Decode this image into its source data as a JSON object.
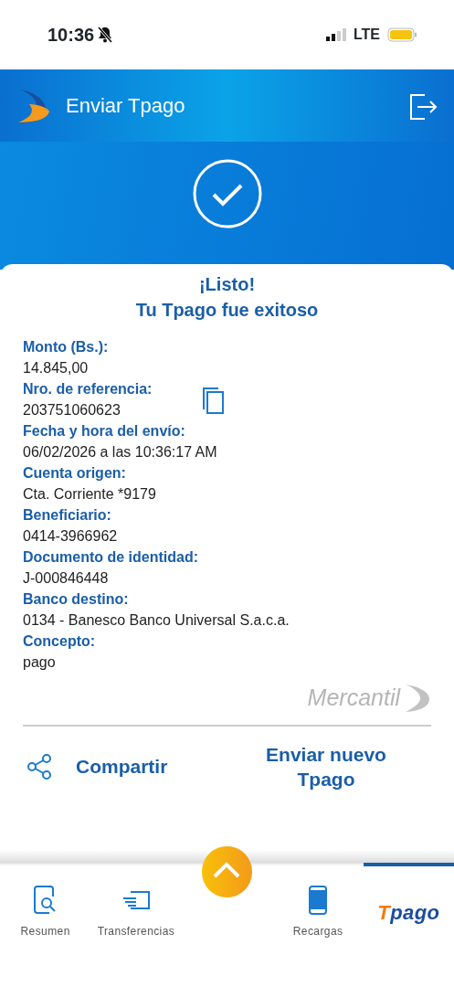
{
  "status_bar": {
    "time": "10:36",
    "network": "LTE",
    "silenced": true
  },
  "header": {
    "title": "Enviar Tpago"
  },
  "receipt": {
    "title": "¡Listo!",
    "subtitle": "Tu Tpago fue exitoso",
    "fields": [
      {
        "label": "Monto (Bs.):",
        "value": "14.845,00",
        "copyable": false
      },
      {
        "label": "Nro. de referencia:",
        "value": "203751060623",
        "copyable": true
      },
      {
        "label": "Fecha y hora del envío:",
        "value": "06/02/2026 a las 10:36:17 AM",
        "copyable": false
      },
      {
        "label": "Cuenta origen:",
        "value": "Cta. Corriente *9179",
        "copyable": false
      },
      {
        "label": "Beneficiario:",
        "value": "0414-3966962",
        "copyable": false
      },
      {
        "label": "Documento de identidad:",
        "value": "J-000846448",
        "copyable": false
      },
      {
        "label": "Banco destino:",
        "value": "0134 - Banesco Banco Universal S.a.c.a.",
        "copyable": false
      },
      {
        "label": "Concepto:",
        "value": "pago",
        "copyable": false
      }
    ],
    "brand": "Mercantil"
  },
  "actions": [
    {
      "kind": "share",
      "label": "Compartir"
    },
    {
      "kind": "new",
      "label": "Enviar nuevo Tpago"
    }
  ],
  "nav": [
    {
      "kind": "summary",
      "label": "Resumen",
      "selected": false
    },
    {
      "kind": "transfer",
      "label": "Transferencias",
      "selected": false
    },
    {
      "kind": "up",
      "selected": false
    },
    {
      "kind": "topup",
      "label": "Recargas",
      "selected": false
    },
    {
      "kind": "tpago",
      "label": "Tpago",
      "selected": true
    }
  ]
}
